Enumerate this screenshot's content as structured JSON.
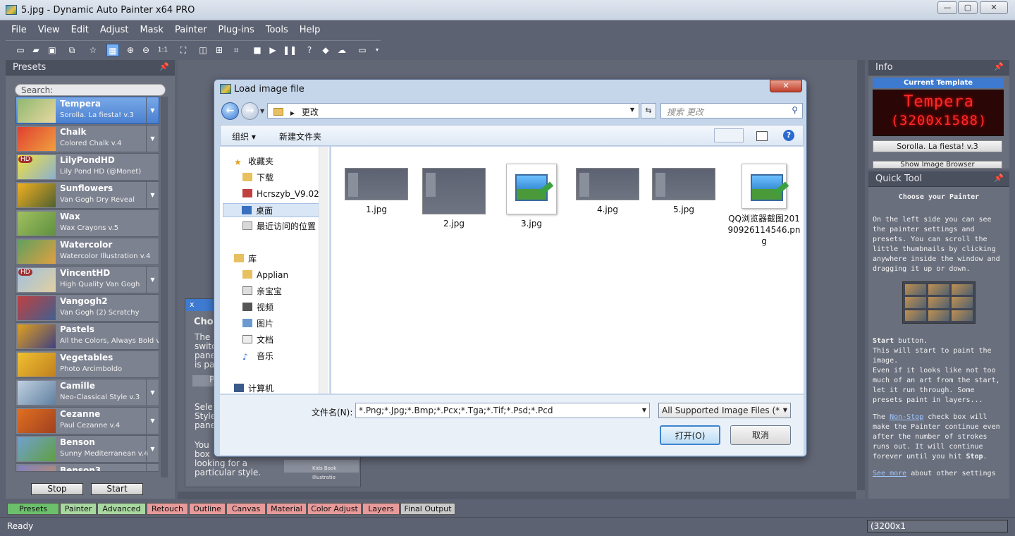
{
  "window": {
    "title": "5.jpg - Dynamic Auto Painter x64 PRO",
    "buttons": [
      "—",
      "▢",
      "✕"
    ]
  },
  "menu": [
    "File",
    "View",
    "Edit",
    "Adjust",
    "Mask",
    "Painter",
    "Plug-ins",
    "Tools",
    "Help"
  ],
  "toolbar": {
    "zoom_label": "1:1"
  },
  "presets_panel": {
    "title": "Presets",
    "search_placeholder": "Search:",
    "items": [
      {
        "name": "Tempera",
        "sub": "Sorolla. La fiesta! v.3",
        "selected": true,
        "hd": ""
      },
      {
        "name": "Chalk",
        "sub": "Colored Chalk v.4",
        "hd": ""
      },
      {
        "name": "LilyPondHD",
        "sub": "Lily Pond HD (@Monet)",
        "hd": "HD"
      },
      {
        "name": "Sunflowers",
        "sub": "Van Gogh Dry Reveal",
        "hd": ""
      },
      {
        "name": "Wax",
        "sub": "Wax Crayons v.5",
        "hd": ""
      },
      {
        "name": "Watercolor",
        "sub": "Watercolor Illustration v.4",
        "hd": ""
      },
      {
        "name": "VincentHD",
        "sub": "High Quality Van Gogh",
        "hd": "HD"
      },
      {
        "name": "Vangogh2",
        "sub": "Van Gogh (2) Scratchy",
        "hd": ""
      },
      {
        "name": "Pastels",
        "sub": "All the Colors, Always Bold v",
        "hd": ""
      },
      {
        "name": "Vegetables",
        "sub": "Photo Arcimboldo",
        "hd": ""
      },
      {
        "name": "Camille",
        "sub": "Neo-Classical Style v.3",
        "hd": ""
      },
      {
        "name": "Cezanne",
        "sub": "Paul Cezanne v.4",
        "hd": ""
      },
      {
        "name": "Benson",
        "sub": "Sunny Mediterranean v.4",
        "hd": ""
      },
      {
        "name": "Benson3",
        "sub": "",
        "hd": ""
      }
    ],
    "stop_label": "Stop",
    "start_label": "Start"
  },
  "help_panel": {
    "close": "x",
    "title": "Choo",
    "lines1": [
      "The",
      "switc",
      "pane",
      "is pa"
    ],
    "lines2": [
      "Sele",
      "Style",
      "pane"
    ],
    "lines3": [
      "You",
      "box",
      "looking for a",
      "particular style."
    ],
    "btn": "P",
    "thumb_caption": "Kids Book Illustratio"
  },
  "info_panel": {
    "title": "Info",
    "current_template": "Current Template",
    "led_name": "Tempera",
    "led_size": "(3200x1588)",
    "template_sub": "Sorolla. La fiesta! v.3",
    "browser_btn": "Show Image Browser"
  },
  "quick_tool": {
    "title": "Quick Tool",
    "heading": "Choose your Painter",
    "para1": "On the left side you can see the painter settings and presets. You can scroll the little thumbnails by clicking anywhere inside the window and dragging it up or down.",
    "start_word": "Start",
    "start_rest": " button.",
    "para2": "This will start to paint the image.",
    "para3": "Even if it looks like not too much of an art from the start, let it run through. Some presets paint in layers...",
    "para4_a": "The ",
    "nonstop": "Non-Stop",
    "para4_b": " check box will make the Painter continue even after the number of strokes runs out. It will continue forever until you hit ",
    "stop_word": "Stop",
    "para4_c": ".",
    "see_more": "See more",
    "para5": " about other settings"
  },
  "bottom_tabs": [
    "Presets",
    "Painter",
    "Advanced",
    "Retouch",
    "Outline",
    "Canvas",
    "Material",
    "Color Adjust",
    "Layers",
    "Final Output"
  ],
  "status": {
    "text": "Ready",
    "size": "(3200x1"
  },
  "dialog": {
    "title": "Load image file",
    "close": "✕",
    "path": "更改",
    "search_placeholder": "搜索 更改",
    "organize": "组织 ▾",
    "new_folder": "新建文件夹",
    "nav": {
      "favorites": "收藏夹",
      "fav_items": [
        "下载",
        "Hcrszyb_V9.02_",
        "桌面",
        "最近访问的位置"
      ],
      "library": "库",
      "lib_items": [
        "Applian",
        "亲宝宝",
        "视频",
        "图片",
        "文档",
        "音乐"
      ],
      "computer": "计算机"
    },
    "files": [
      {
        "name": "1.jpg",
        "kind": "shot"
      },
      {
        "name": "2.jpg",
        "kind": "shot"
      },
      {
        "name": "3.jpg",
        "kind": "icon"
      },
      {
        "name": "4.jpg",
        "kind": "shot"
      },
      {
        "name": "5.jpg",
        "kind": "shot"
      },
      {
        "name": "QQ浏览器截图20190926114546.png",
        "kind": "icon"
      }
    ],
    "filename_label": "文件名(N):",
    "filename_value": "*.Png;*.Jpg;*.Bmp;*.Pcx;*.Tga;*.Tif;*.Psd;*.Pcd",
    "filetype": "All Supported Image Files (*",
    "open_btn": "打开(O)",
    "cancel_btn": "取消"
  }
}
